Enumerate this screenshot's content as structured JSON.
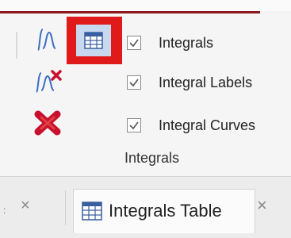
{
  "ribbon": {
    "checkboxes": [
      {
        "label": "Integrals",
        "checked": true
      },
      {
        "label": "Integral Labels",
        "checked": true
      },
      {
        "label": "Integral Curves",
        "checked": true
      }
    ],
    "group_label": "Integrals",
    "icons": {
      "integral": "integral-icon",
      "delete_integral": "delete-integral-icon",
      "delete_all": "delete-all-integrals-icon",
      "table": "table-icon"
    },
    "highlight_color": "#e01a1a",
    "accent_color": "#8c1a1a"
  },
  "tabs": {
    "left_tab_close": "×",
    "active": {
      "label": "Integrals Table",
      "close": "×"
    }
  }
}
